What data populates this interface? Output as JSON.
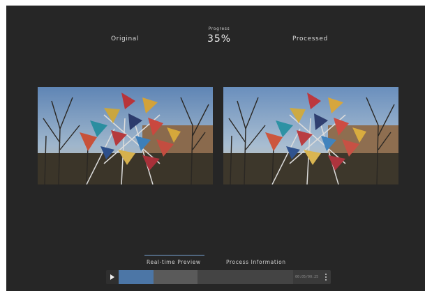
{
  "labels": {
    "original": "Original",
    "processed": "Processed"
  },
  "progress": {
    "title": "Progress",
    "value_text": "35%",
    "percent": 35
  },
  "tabs": [
    {
      "label": "Real-time Preview",
      "active": true
    },
    {
      "label": "Process Information",
      "active": false
    }
  ],
  "player": {
    "time_text": "00:05/00:25",
    "played_fraction": 0.2,
    "buffered_fraction": 0.45
  },
  "colors": {
    "app_background": "#262626",
    "accent": "#4c76a6",
    "tab_underline": "#7aa6d6"
  },
  "icons": {
    "play": "play-icon",
    "more": "more-vertical-icon"
  }
}
